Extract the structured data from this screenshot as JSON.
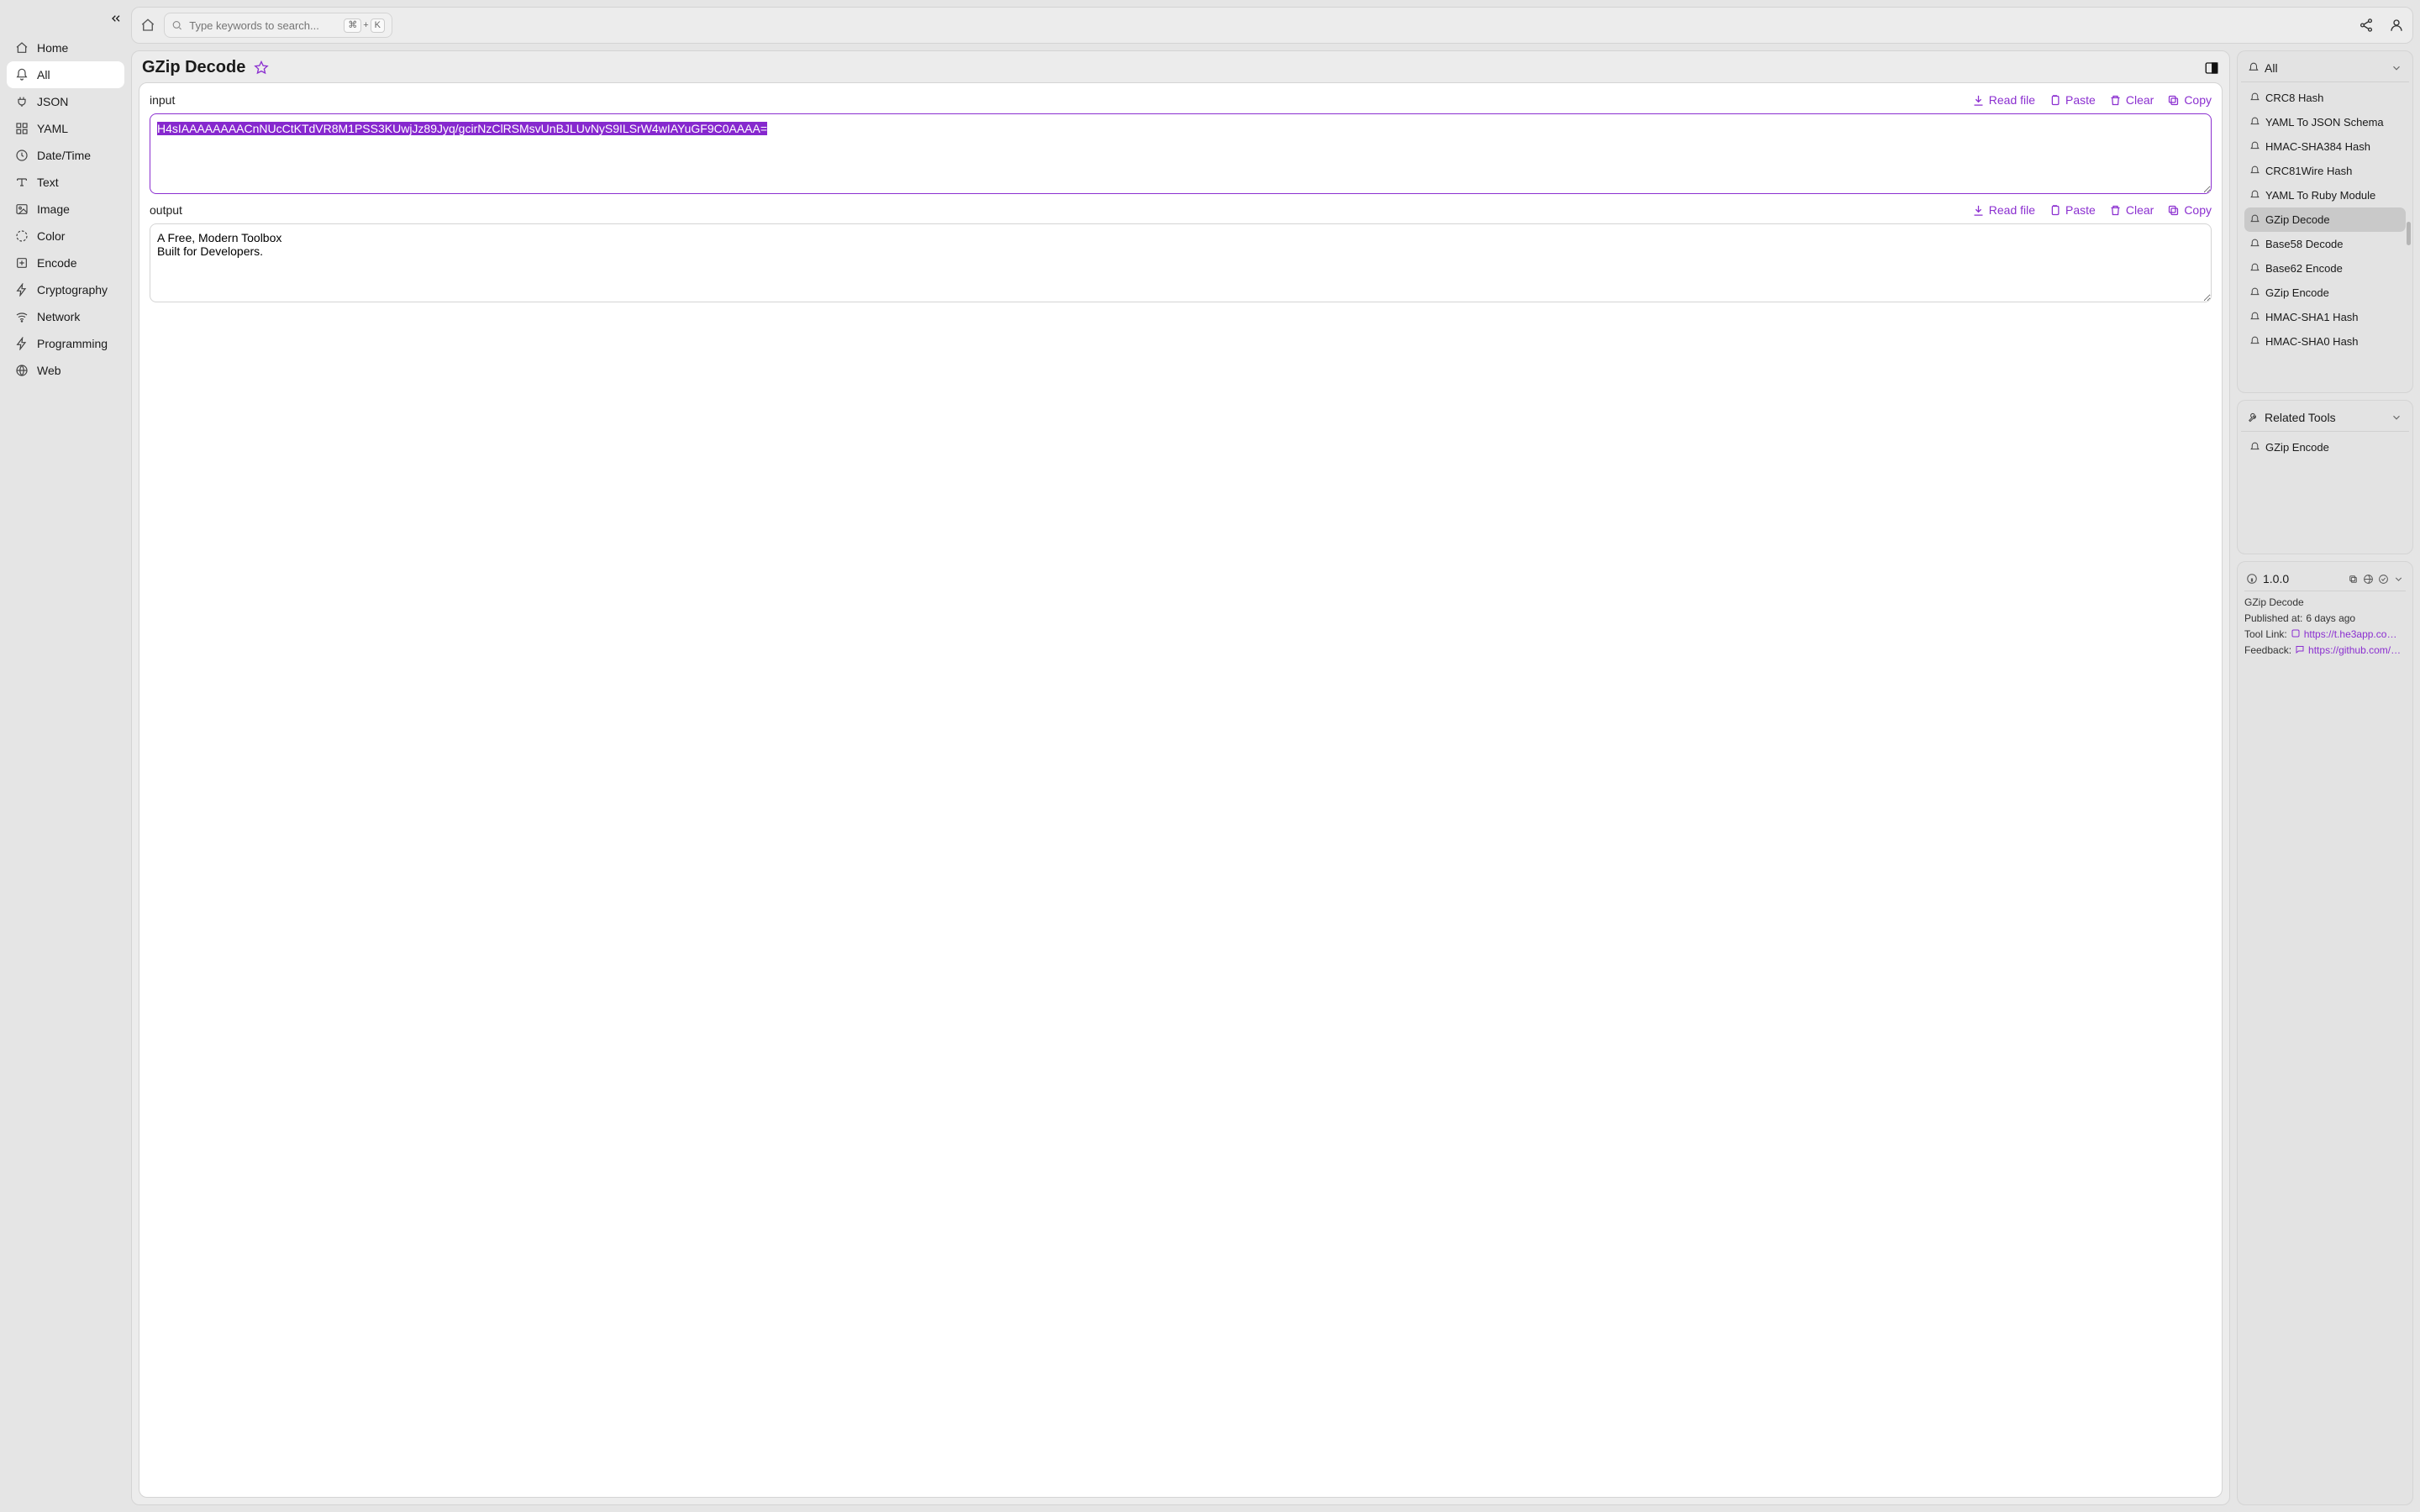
{
  "search": {
    "placeholder": "Type keywords to search...",
    "kbd1": "⌘",
    "plus": "+",
    "kbd2": "K"
  },
  "sidebar": {
    "items": [
      {
        "label": "Home"
      },
      {
        "label": "All"
      },
      {
        "label": "JSON"
      },
      {
        "label": "YAML"
      },
      {
        "label": "Date/Time"
      },
      {
        "label": "Text"
      },
      {
        "label": "Image"
      },
      {
        "label": "Color"
      },
      {
        "label": "Encode"
      },
      {
        "label": "Cryptography"
      },
      {
        "label": "Network"
      },
      {
        "label": "Programming"
      },
      {
        "label": "Web"
      }
    ]
  },
  "page": {
    "title": "GZip Decode"
  },
  "io": {
    "input_label": "input",
    "output_label": "output",
    "read_file": "Read file",
    "paste": "Paste",
    "clear": "Clear",
    "copy": "Copy",
    "input_value": "H4sIAAAAAAAACnNUcCtKTdVR8M1PSS3KUwjJz89Jyq/gcirNzClRSMsvUnBJLUvNyS9ILSrW4wIAYuGF9C0AAAA=",
    "output_value": "A Free, Modern Toolbox\nBuilt for Developers."
  },
  "rightAll": {
    "header": "All",
    "items": [
      "CRC8 Hash",
      "YAML To JSON Schema",
      "HMAC-SHA384 Hash",
      "CRC81Wire Hash",
      "YAML To Ruby Module",
      "GZip Decode",
      "Base58 Decode",
      "Base62 Encode",
      "GZip Encode",
      "HMAC-SHA1 Hash",
      "HMAC-SHA0 Hash"
    ],
    "activeIndex": 5
  },
  "related": {
    "header": "Related Tools",
    "items": [
      "GZip Encode"
    ]
  },
  "meta": {
    "version": "1.0.0",
    "name": "GZip Decode",
    "published_label": "Published at:",
    "published_value": "6 days ago",
    "tool_link_label": "Tool Link:",
    "tool_link": "https://t.he3app.co…",
    "feedback_label": "Feedback:",
    "feedback_link": "https://github.com/…"
  }
}
